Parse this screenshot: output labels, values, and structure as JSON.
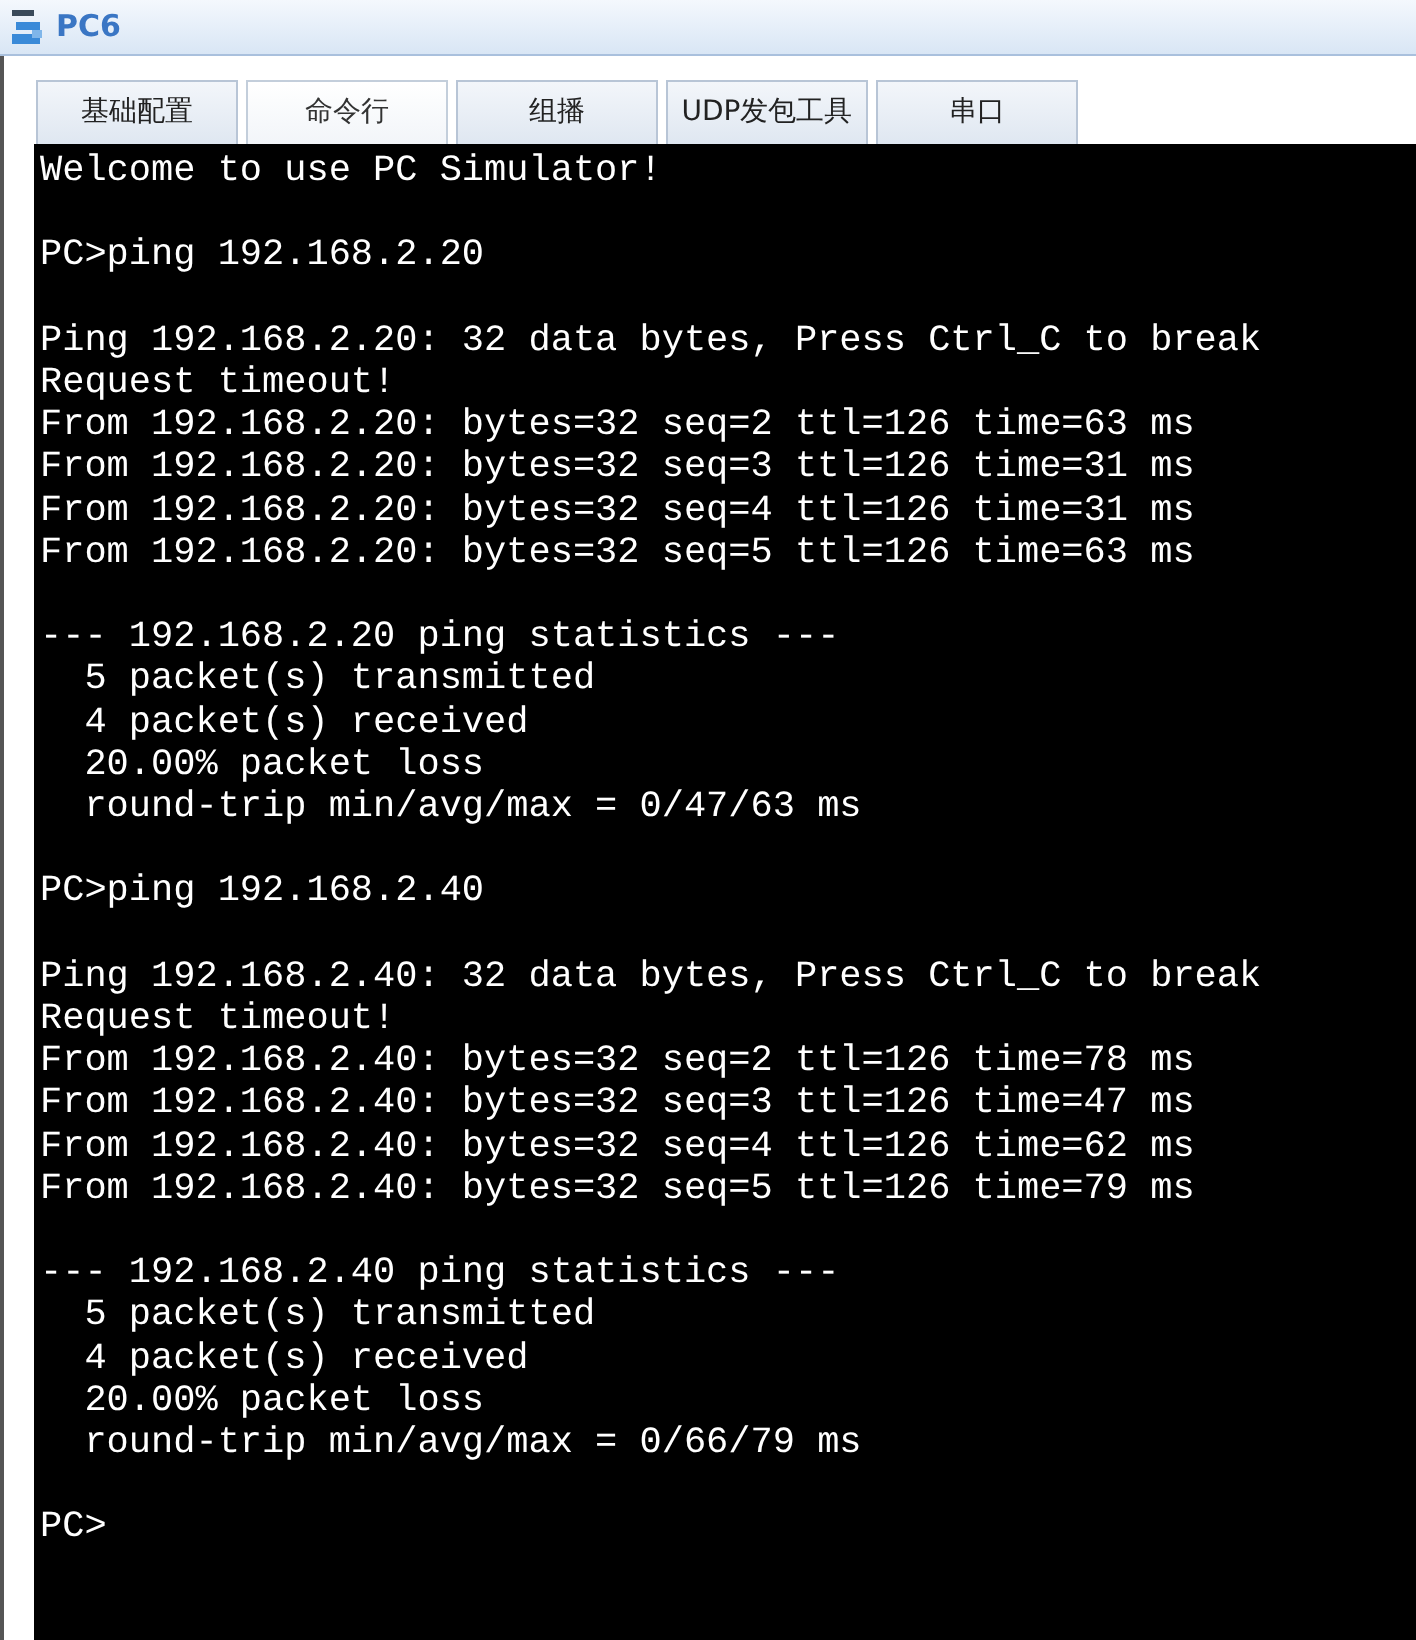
{
  "window": {
    "title": "PC6"
  },
  "tabs": [
    {
      "label": "基础配置",
      "selected": false
    },
    {
      "label": "命令行",
      "selected": true
    },
    {
      "label": "组播",
      "selected": false
    },
    {
      "label": "UDP发包工具",
      "selected": false
    },
    {
      "label": "串口",
      "selected": false
    }
  ],
  "terminal": {
    "blocks": [
      [
        "Welcome to use PC Simulator!"
      ],
      [
        "PC>ping 192.168.2.20"
      ],
      [
        "Ping 192.168.2.20: 32 data bytes, Press Ctrl_C to break",
        "Request timeout!",
        "From 192.168.2.20: bytes=32 seq=2 ttl=126 time=63 ms",
        "From 192.168.2.20: bytes=32 seq=3 ttl=126 time=31 ms",
        "From 192.168.2.20: bytes=32 seq=4 ttl=126 time=31 ms",
        "From 192.168.2.20: bytes=32 seq=5 ttl=126 time=63 ms"
      ],
      [
        "--- 192.168.2.20 ping statistics ---",
        "  5 packet(s) transmitted",
        "  4 packet(s) received",
        "  20.00% packet loss",
        "  round-trip min/avg/max = 0/47/63 ms"
      ],
      [
        "PC>ping 192.168.2.40"
      ],
      [
        "Ping 192.168.2.40: 32 data bytes, Press Ctrl_C to break",
        "Request timeout!",
        "From 192.168.2.40: bytes=32 seq=2 ttl=126 time=78 ms",
        "From 192.168.2.40: bytes=32 seq=3 ttl=126 time=47 ms",
        "From 192.168.2.40: bytes=32 seq=4 ttl=126 time=62 ms",
        "From 192.168.2.40: bytes=32 seq=5 ttl=126 time=79 ms"
      ],
      [
        "--- 192.168.2.40 ping statistics ---",
        "  5 packet(s) transmitted",
        "  4 packet(s) received",
        "  20.00% packet loss",
        "  round-trip min/avg/max = 0/66/79 ms"
      ],
      [
        "PC>"
      ]
    ]
  }
}
